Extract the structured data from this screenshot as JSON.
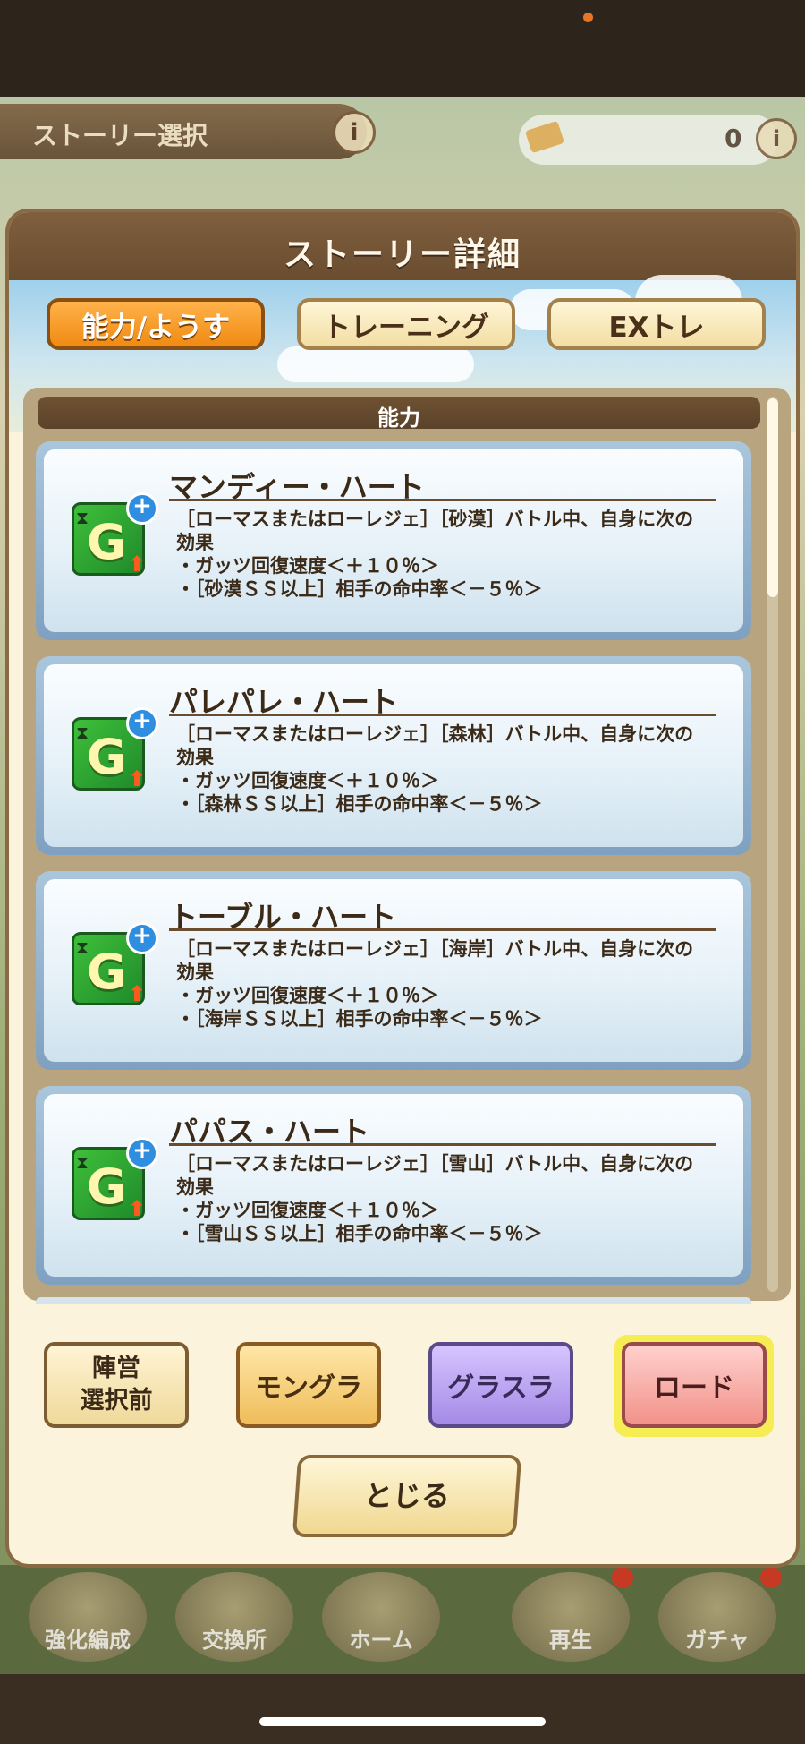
{
  "background": {
    "screen_title": "ストーリー選択",
    "info_icon": "i",
    "currency_amount": "0",
    "nav_items": [
      "強化編成",
      "交換所",
      "ホーム",
      "再生",
      "ガチャ"
    ]
  },
  "modal": {
    "title": "ストーリー詳細",
    "tabs": [
      {
        "label": "能力/ようす",
        "active": true
      },
      {
        "label": "トレーニング",
        "active": false
      },
      {
        "label": "EXトレ",
        "active": false
      }
    ],
    "section_title": "能力",
    "abilities": [
      {
        "name": "マンディー・ハート",
        "lines": [
          "［ローマスまたはローレジェ］［砂漠］バトル中、自身に次の",
          "効果",
          "・ガッツ回復速度＜＋１０％＞",
          "・［砂漠ＳＳ以上］相手の命中率＜－５％＞"
        ]
      },
      {
        "name": "パレパレ・ハート",
        "lines": [
          "［ローマスまたはローレジェ］［森林］バトル中、自身に次の",
          "効果",
          "・ガッツ回復速度＜＋１０％＞",
          "・［森林ＳＳ以上］相手の命中率＜－５％＞"
        ]
      },
      {
        "name": "トーブル・ハート",
        "lines": [
          "［ローマスまたはローレジェ］［海岸］バトル中、自身に次の",
          "効果",
          "・ガッツ回復速度＜＋１０％＞",
          "・［海岸ＳＳ以上］相手の命中率＜－５％＞"
        ]
      },
      {
        "name": "パパス・ハート",
        "lines": [
          "［ローマスまたはローレジェ］［雪山］バトル中、自身に次の",
          "効果",
          "・ガッツ回復速度＜＋１０％＞",
          "・［雪山ＳＳ以上］相手の命中率＜－５％＞"
        ]
      }
    ],
    "filter_buttons": {
      "faction_line1": "陣営",
      "faction_line2": "選択前",
      "mongra": "モングラ",
      "grasla": "グラスラ",
      "road": "ロード"
    },
    "close_label": "とじる"
  },
  "colors": {
    "active_tab": "#f08a12",
    "header_brown": "#6a4c2f",
    "road_highlight": "#f6ec53"
  }
}
